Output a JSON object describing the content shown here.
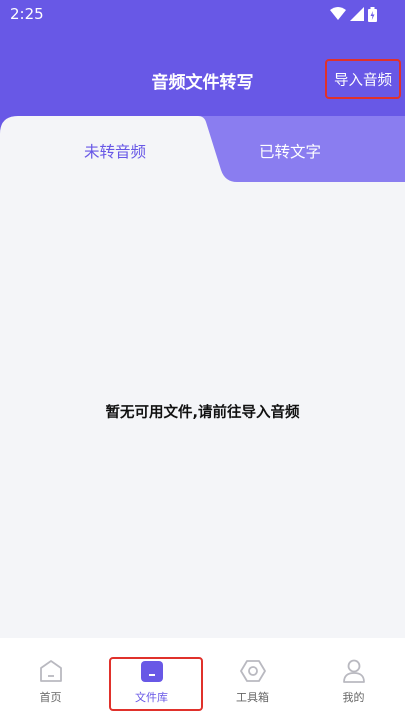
{
  "status_bar": {
    "time": "2:25",
    "icons": [
      "wifi-icon",
      "signal-icon",
      "battery-icon"
    ]
  },
  "header": {
    "title": "音频文件转写",
    "import_button": "导入音频"
  },
  "tabs": [
    {
      "label": "未转音频",
      "selected": true
    },
    {
      "label": "已转文字",
      "selected": false
    }
  ],
  "content": {
    "empty_message": "暂无可用文件,请前往导入音频"
  },
  "bottom_nav": {
    "items": [
      {
        "label": "首页",
        "icon": "home-icon",
        "selected": false
      },
      {
        "label": "文件库",
        "icon": "folder-icon",
        "selected": true
      },
      {
        "label": "工具箱",
        "icon": "hexagon-tools-icon",
        "selected": false
      },
      {
        "label": "我的",
        "icon": "person-icon",
        "selected": false
      }
    ]
  },
  "colors": {
    "primary": "#6858e6",
    "tab_inactive_bg": "#8a7df0",
    "highlight": "#e0312b",
    "background": "#f4f5f8"
  }
}
